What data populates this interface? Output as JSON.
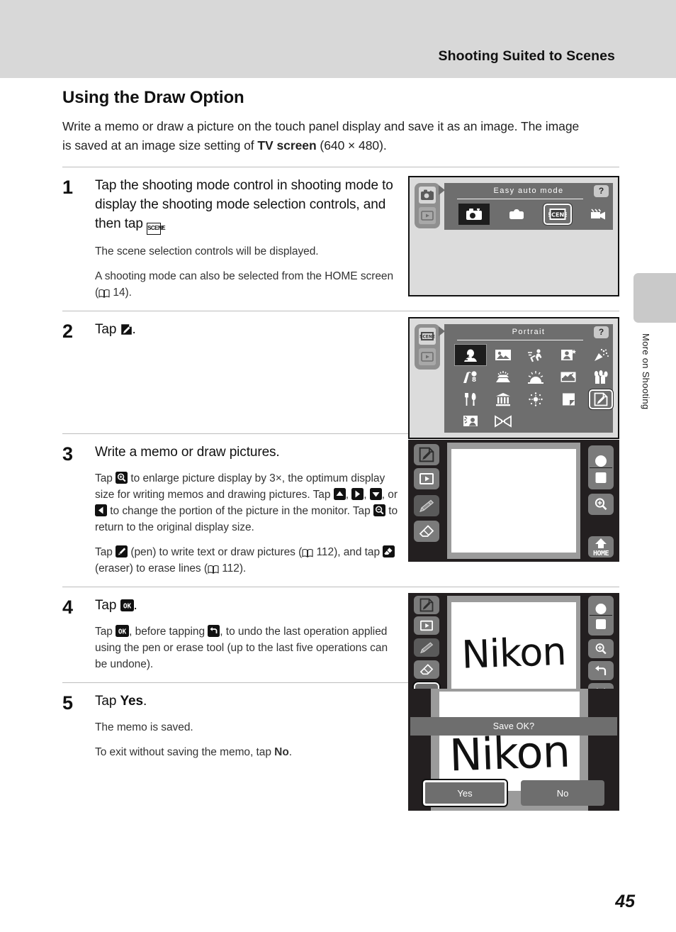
{
  "header": {
    "running_head": "Shooting Suited to Scenes"
  },
  "side_tab": {
    "label": "More on Shooting"
  },
  "page": {
    "number": "45"
  },
  "section": {
    "title": "Using the Draw Option",
    "intro_1": "Write a memo or draw a picture on the touch panel display and save it as an image. The image is saved at an image size setting of ",
    "intro_bold": "TV screen",
    "intro_2": " (640 × 480)."
  },
  "steps": [
    {
      "number": "1",
      "head_1": "Tap the shooting mode control in shooting mode to display the shooting mode selection controls, and then tap ",
      "head_icon": "scene-icon",
      "head_2": ".",
      "desc_1": "The scene selection controls will be displayed.",
      "desc_2a": "A shooting mode can also be selected from the HOME screen (",
      "desc_2_ref": "14",
      "desc_2b": ")."
    },
    {
      "number": "2",
      "head_1": "Tap ",
      "head_icon": "draw-icon",
      "head_2": "."
    },
    {
      "number": "3",
      "head": "Write a memo or draw pictures.",
      "desc_1a": "Tap ",
      "desc_1b": " to enlarge picture display by 3×, the optimum display size for writing memos and drawing pictures. Tap ",
      "desc_1c": ", ",
      "desc_1d": ", ",
      "desc_1e": ", or ",
      "desc_1f": " to change the portion of the picture in the monitor. Tap ",
      "desc_1g": " to return to the original display size.",
      "desc_2a": "Tap ",
      "desc_2b": " (pen) to write text or draw pictures (",
      "desc_2_ref1": "112",
      "desc_2c": "), and tap ",
      "desc_2d": " (eraser) to erase lines (",
      "desc_2_ref2": "112",
      "desc_2e": ")."
    },
    {
      "number": "4",
      "head_1": "Tap ",
      "head_icon": "ok-icon",
      "head_2": ".",
      "desc_1a": "Tap ",
      "desc_1b": ", before tapping ",
      "desc_1c": ", to undo the last operation applied using the pen or erase tool (up to the last five operations can be undone)."
    },
    {
      "number": "5",
      "head_1": "Tap ",
      "head_bold": "Yes",
      "head_2": ".",
      "desc_1": "The memo is saved.",
      "desc_2a": "To exit without saving the memo, tap ",
      "desc_2_bold": "No",
      "desc_2b": "."
    }
  ],
  "screens": {
    "mode_select": {
      "title": "Easy auto mode",
      "help": "?",
      "modes": [
        {
          "name": "easy-auto-mode-icon",
          "selected": true
        },
        {
          "name": "auto-mode-icon",
          "selected": false
        },
        {
          "name": "scene-mode-icon",
          "selected": false,
          "boxed": true,
          "label": "SCENE"
        },
        {
          "name": "movie-mode-icon",
          "selected": false
        }
      ],
      "rail": [
        {
          "name": "shooting-mode-icon"
        },
        {
          "name": "playback-mode-icon"
        }
      ]
    },
    "scene_select": {
      "title": "Portrait",
      "help": "?",
      "rail": [
        {
          "name": "scene-mode-icon",
          "label": "SCENE"
        },
        {
          "name": "playback-mode-icon"
        }
      ],
      "scenes": [
        {
          "name": "portrait-scene-icon",
          "selected": true
        },
        {
          "name": "landscape-scene-icon"
        },
        {
          "name": "sports-scene-icon"
        },
        {
          "name": "night-portrait-scene-icon"
        },
        {
          "name": "party-indoor-scene-icon"
        },
        {
          "name": "beach-scene-icon"
        },
        {
          "name": "snow-scene-icon"
        },
        {
          "name": "sunset-scene-icon"
        },
        {
          "name": "dusk-dawn-scene-icon"
        },
        {
          "name": "close-up-scene-icon"
        },
        {
          "name": "food-scene-icon"
        },
        {
          "name": "museum-scene-icon"
        },
        {
          "name": "fireworks-scene-icon"
        },
        {
          "name": "copy-scene-icon"
        },
        {
          "name": "draw-scene-icon",
          "boxed": true
        },
        {
          "name": "backlight-scene-icon"
        },
        {
          "name": "panorama-scene-icon"
        }
      ]
    },
    "draw_blank": {
      "left_rail": [
        {
          "name": "draw-mode-icon"
        },
        {
          "name": "playback-mode-icon"
        },
        {
          "name": "pen-tool-icon"
        },
        {
          "name": "eraser-tool-icon"
        }
      ],
      "right_rail": [
        {
          "name": "record-dot-icon"
        },
        {
          "name": "record-stop-icon"
        },
        {
          "name": "zoom-in-icon"
        },
        {
          "name": "home-button-icon",
          "label": "HOME"
        }
      ],
      "canvas_text": ""
    },
    "draw_nikon": {
      "left_rail": [
        {
          "name": "draw-mode-icon"
        },
        {
          "name": "playback-mode-icon"
        },
        {
          "name": "pen-tool-icon"
        },
        {
          "name": "eraser-tool-icon"
        },
        {
          "name": "ok-button-icon",
          "label": "OK",
          "selected": true
        }
      ],
      "right_rail": [
        {
          "name": "record-dot-icon"
        },
        {
          "name": "record-stop-icon"
        },
        {
          "name": "zoom-in-icon"
        },
        {
          "name": "undo-icon"
        },
        {
          "name": "close-icon"
        }
      ],
      "canvas_text": "Nikon"
    },
    "save_confirm": {
      "prompt": "Save OK?",
      "canvas_text": "Nikon",
      "yes_label": "Yes",
      "no_label": "No"
    }
  }
}
